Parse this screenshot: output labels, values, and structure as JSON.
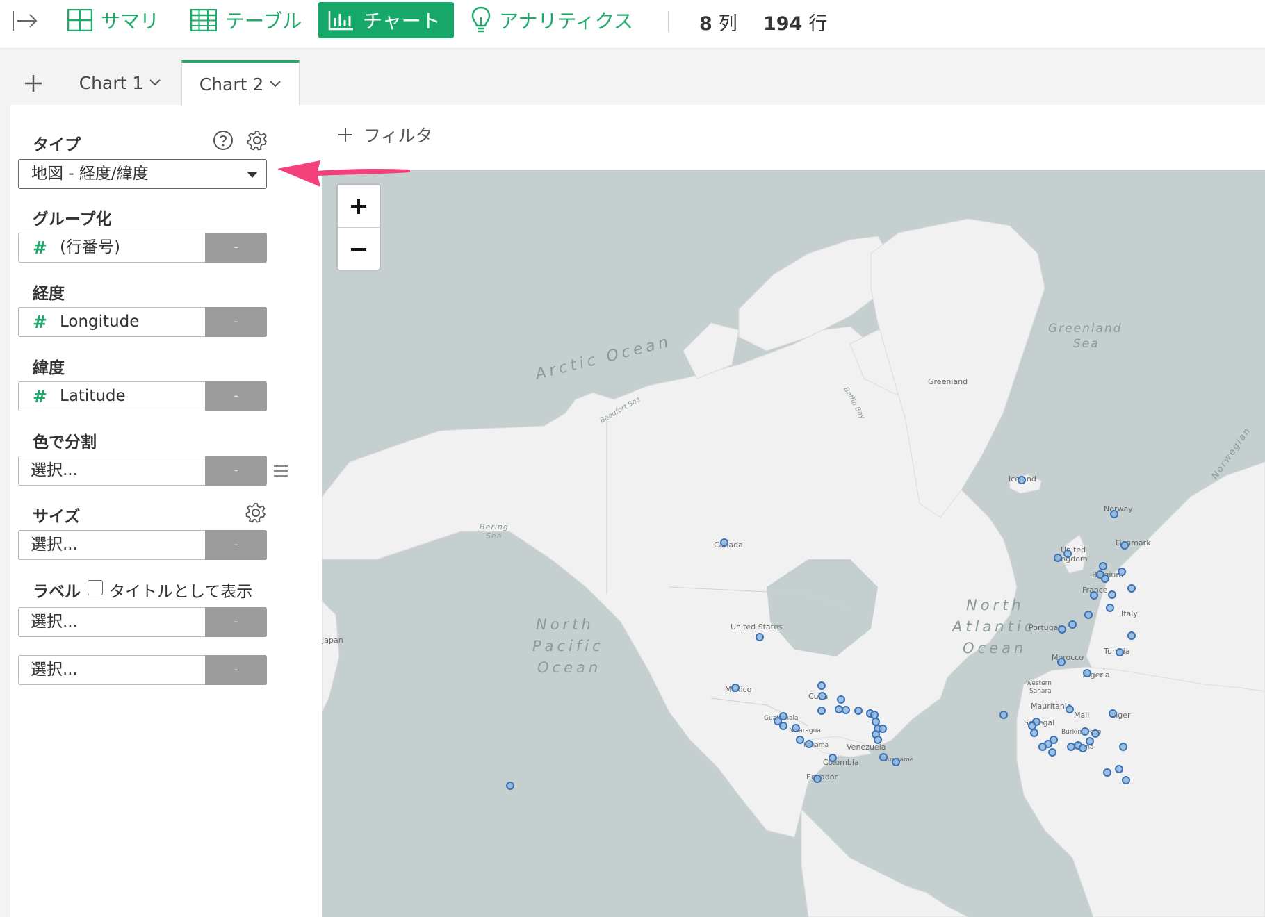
{
  "nav": {
    "items": [
      {
        "label": "サマリ",
        "icon": "grid-icon"
      },
      {
        "label": "テーブル",
        "icon": "table-icon"
      },
      {
        "label": "チャート",
        "icon": "bar-chart-icon",
        "active": true
      },
      {
        "label": "アナリティクス",
        "icon": "lightbulb-icon"
      }
    ],
    "columns_count": "8",
    "columns_unit": "列",
    "rows_count": "194",
    "rows_unit": "行"
  },
  "tabs": [
    {
      "label": "Chart 1",
      "active": false
    },
    {
      "label": "Chart 2",
      "active": true
    }
  ],
  "panel": {
    "type_label": "タイプ",
    "type_value": "地図 - 経度/緯度",
    "group_label": "グループ化",
    "group_value": "(行番号)",
    "longitude_label": "経度",
    "longitude_value": "Longitude",
    "latitude_label": "緯度",
    "latitude_value": "Latitude",
    "color_label": "色で分割",
    "size_label": "サイズ",
    "label_label": "ラベル",
    "label_checkbox": "タイトルとして表示",
    "placeholder": "選択...",
    "remove": "-"
  },
  "filter_label": "フィルタ",
  "map": {
    "zoom_in": "+",
    "zoom_out": "−",
    "labels": {
      "arctic": "Arctic Ocean",
      "greenland_sea_1": "Greenland",
      "greenland_sea_2": "Sea",
      "greenland": "Greenland",
      "baffin": "Baffin Bay",
      "beaufort": "Beaufort Sea",
      "norwegian": "Norwegian",
      "iceland": "Iceland",
      "norway": "Norway",
      "bering_1": "Bering",
      "bering_2": "Sea",
      "canada": "Canada",
      "denmark": "Denmark",
      "uk_1": "United",
      "uk_2": "Kingdom",
      "belgium": "Belgium",
      "france": "France",
      "portugal": "Portugal",
      "tunisia": "Tunisia",
      "morocco": "Morocco",
      "algeria": "Algeria",
      "western_sahara_1": "Western",
      "western_sahara_2": "Sahara",
      "mauritania": "Mauritania",
      "mali": "Mali",
      "niger": "Niger",
      "senegal": "Senegal",
      "burkina": "Burkina Faso",
      "ghana": "Ghana",
      "npo_1": "North",
      "npo_2": "Pacific",
      "npo_3": "Ocean",
      "nao_1": "North",
      "nao_2": "Atlantic",
      "nao_3": "Ocean",
      "us": "United States",
      "japan": "Japan",
      "mexico": "Mexico",
      "cuba": "Cuba",
      "guatemala": "Guatemala",
      "nicaragua": "Nicaragua",
      "panama": "Panama",
      "venezuela": "Venezuela",
      "colombia": "Colombia",
      "suriname": "Suriname",
      "ecuador": "Ecuador",
      "italy": "Italy"
    }
  }
}
